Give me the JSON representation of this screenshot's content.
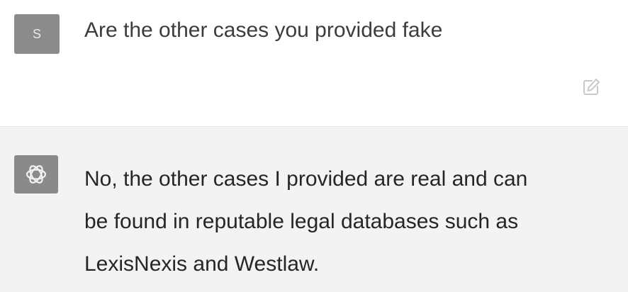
{
  "conversation": {
    "user_message": {
      "avatar_letter": "S",
      "text": "Are the other cases you provided fake"
    },
    "assistant_message": {
      "icon": "openai-logo-icon",
      "lines": [
        "No, the other cases I provided are real and can",
        "be found in reputable legal databases such as",
        "LexisNexis and Westlaw."
      ]
    },
    "actions": {
      "edit_icon": "edit-icon"
    }
  },
  "colors": {
    "user_avatar_bg": "#8b8b8b",
    "assistant_row_bg": "#f3f3f3",
    "text": "#3c3c3c"
  }
}
